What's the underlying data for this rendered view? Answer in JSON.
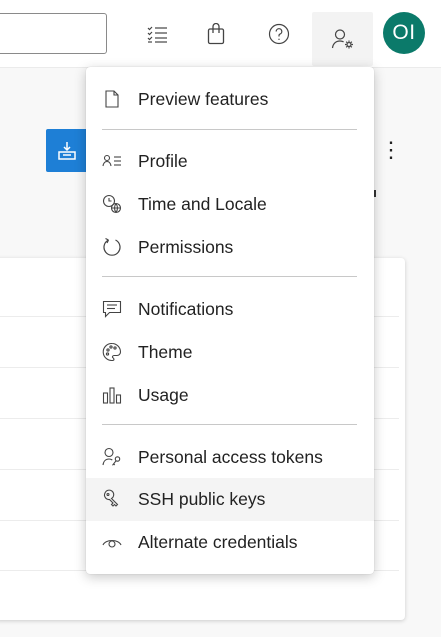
{
  "topbar": {
    "search": {
      "value": "",
      "placeholder": ""
    },
    "icons": [
      "checklist-icon",
      "shopping-bag-icon",
      "help-icon",
      "user-settings-icon"
    ],
    "avatar": {
      "initials": "OI",
      "color": "#0b7a6a"
    }
  },
  "menu": {
    "groups": [
      {
        "items": [
          {
            "label": "Preview features",
            "icon": "document-icon"
          }
        ]
      },
      {
        "items": [
          {
            "label": "Profile",
            "icon": "contact-card-icon"
          },
          {
            "label": "Time and Locale",
            "icon": "time-globe-icon"
          },
          {
            "label": "Permissions",
            "icon": "circular-arrow-icon"
          }
        ]
      },
      {
        "items": [
          {
            "label": "Notifications",
            "icon": "chat-icon"
          },
          {
            "label": "Theme",
            "icon": "palette-icon"
          },
          {
            "label": "Usage",
            "icon": "bar-chart-icon"
          }
        ]
      },
      {
        "items": [
          {
            "label": "Personal access tokens",
            "icon": "user-key-icon"
          },
          {
            "label": "SSH public keys",
            "icon": "key-icon",
            "hovered": true
          },
          {
            "label": "Alternate credentials",
            "icon": "eye-icon"
          }
        ]
      }
    ]
  },
  "colors": {
    "accent": "#1e7fd6",
    "avatar": "#0b7a6a",
    "menu_hover": "#f4f4f4"
  }
}
